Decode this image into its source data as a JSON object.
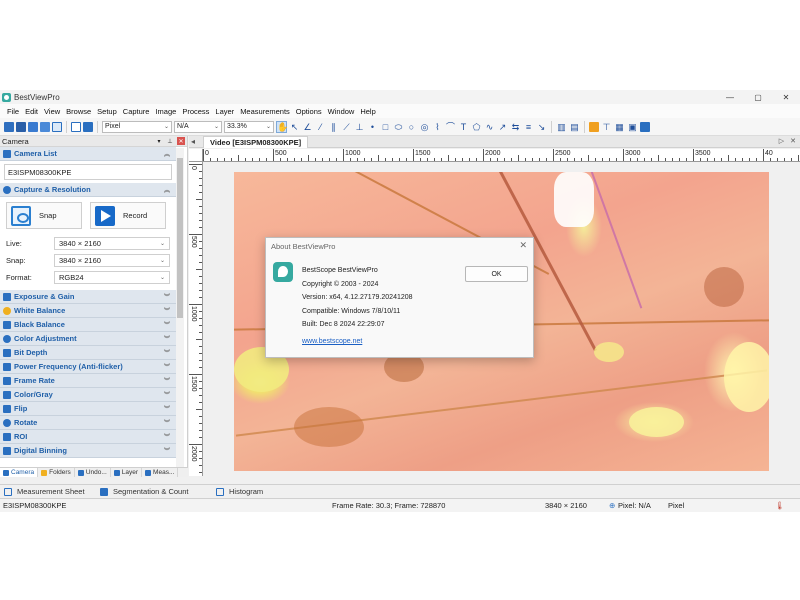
{
  "app": {
    "title": "BestViewPro"
  },
  "window_controls": {
    "minimize": "—",
    "maximize": "▢",
    "close": "✕"
  },
  "menu": [
    "File",
    "Edit",
    "View",
    "Browse",
    "Setup",
    "Capture",
    "Image",
    "Process",
    "Layer",
    "Measurements",
    "Options",
    "Window",
    "Help"
  ],
  "toolbar": {
    "unit": "Pixel",
    "magnification": "N/A",
    "zoom": "33.3%"
  },
  "left_panel": {
    "title": "Camera",
    "camera_list": {
      "title": "Camera List",
      "device": "E3ISPM08300KPE"
    },
    "capture": {
      "title": "Capture & Resolution",
      "snap_label": "Snap",
      "record_label": "Record",
      "live_label": "Live:",
      "live_value": "3840 × 2160",
      "snap_res_label": "Snap:",
      "snap_res_value": "3840 × 2160",
      "format_label": "Format:",
      "format_value": "RGB24"
    },
    "sections": [
      "Exposure & Gain",
      "White Balance",
      "Black Balance",
      "Color Adjustment",
      "Bit Depth",
      "Power Frequency (Anti-flicker)",
      "Frame Rate",
      "Color/Gray",
      "Flip",
      "Rotate",
      "ROI",
      "Digital Binning"
    ],
    "tabs": [
      "Camera",
      "Folders",
      "Undo...",
      "Layer",
      "Meas..."
    ]
  },
  "video": {
    "tab_title": "Video [E3ISPM08300KPE]",
    "ruler_top": [
      "0",
      "500",
      "1000",
      "1500",
      "2000",
      "2500",
      "3000",
      "3500",
      "40"
    ],
    "ruler_left": [
      "0",
      "500",
      "1000",
      "1500",
      "2000"
    ]
  },
  "dialog": {
    "title": "About BestViewPro",
    "product": "BestScope BestViewPro",
    "copyright": "Copyright © 2003 - 2024",
    "version": "Version: x64, 4.12.27179.20241208",
    "compatible": "Compatible: Windows 7/8/10/11",
    "built": "Built: Dec  8 2024 22:29:07",
    "link": "www.bestscope.net",
    "ok_label": "OK"
  },
  "bottom_tabs": [
    "Measurement Sheet",
    "Segmentation & Count",
    "Histogram"
  ],
  "status": {
    "camera": "E3ISPM08300KPE",
    "frame": "Frame Rate: 30.3; Frame: 728870",
    "resolution": "3840 × 2160",
    "pixel_value": "Pixel: N/A",
    "unit": "Pixel"
  },
  "colors": {
    "accent": "#1f5fa8",
    "logo": "#36a9a0",
    "close_red": "#d9534f"
  }
}
